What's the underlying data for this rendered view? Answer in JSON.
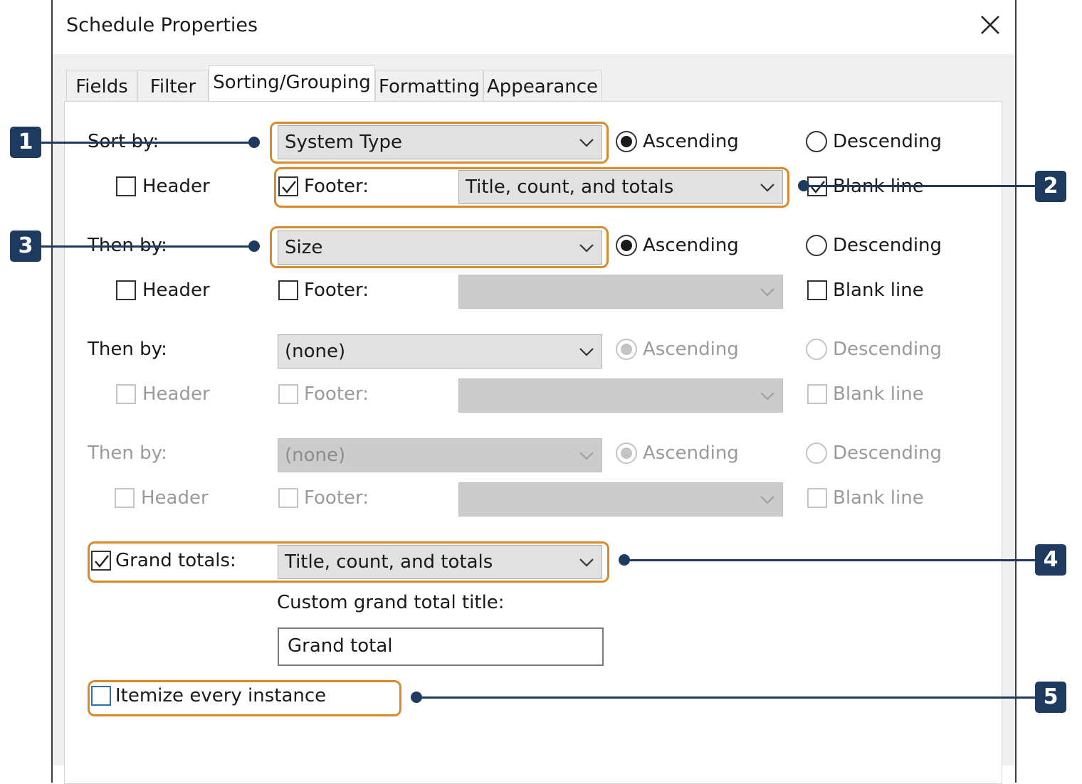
{
  "dialog": {
    "title": "Schedule Properties",
    "close_icon": "close-icon"
  },
  "tabs": [
    {
      "label": "Fields",
      "active": false
    },
    {
      "label": "Filter",
      "active": false
    },
    {
      "label": "Sorting/Grouping",
      "active": true
    },
    {
      "label": "Formatting",
      "active": false
    },
    {
      "label": "Appearance",
      "active": false
    }
  ],
  "groups": [
    {
      "label": "Sort by:",
      "field": "System Type",
      "ascending": "Ascending",
      "descending": "Descending",
      "order": "ascending",
      "header": {
        "label": "Header",
        "checked": false
      },
      "footer": {
        "label": "Footer:",
        "checked": true,
        "value": "Title, count, and totals"
      },
      "blank_line": {
        "label": "Blank line",
        "checked": true
      },
      "enabled": true
    },
    {
      "label": "Then by:",
      "field": "Size",
      "ascending": "Ascending",
      "descending": "Descending",
      "order": "ascending",
      "header": {
        "label": "Header",
        "checked": false
      },
      "footer": {
        "label": "Footer:",
        "checked": false,
        "value": ""
      },
      "blank_line": {
        "label": "Blank line",
        "checked": false
      },
      "enabled": true
    },
    {
      "label": "Then by:",
      "field": "(none)",
      "ascending": "Ascending",
      "descending": "Descending",
      "order": "ascending",
      "header": {
        "label": "Header",
        "checked": false
      },
      "footer": {
        "label": "Footer:",
        "checked": false,
        "value": ""
      },
      "blank_line": {
        "label": "Blank line",
        "checked": false
      },
      "enabled": false
    },
    {
      "label": "Then by:",
      "field": "(none)",
      "ascending": "Ascending",
      "descending": "Descending",
      "order": "ascending",
      "header": {
        "label": "Header",
        "checked": false
      },
      "footer": {
        "label": "Footer:",
        "checked": false,
        "value": ""
      },
      "blank_line": {
        "label": "Blank line",
        "checked": false
      },
      "enabled": false
    }
  ],
  "grand_totals": {
    "label": "Grand totals:",
    "checked": true,
    "value": "Title, count, and totals",
    "custom_title_label": "Custom grand total title:",
    "custom_title_value": "Grand total"
  },
  "itemize": {
    "label": "Itemize every instance",
    "checked": false
  },
  "callouts": [
    "1",
    "2",
    "3",
    "4",
    "5"
  ],
  "colors": {
    "highlight": "#d98a2b",
    "callout": "#1e3a5f"
  }
}
